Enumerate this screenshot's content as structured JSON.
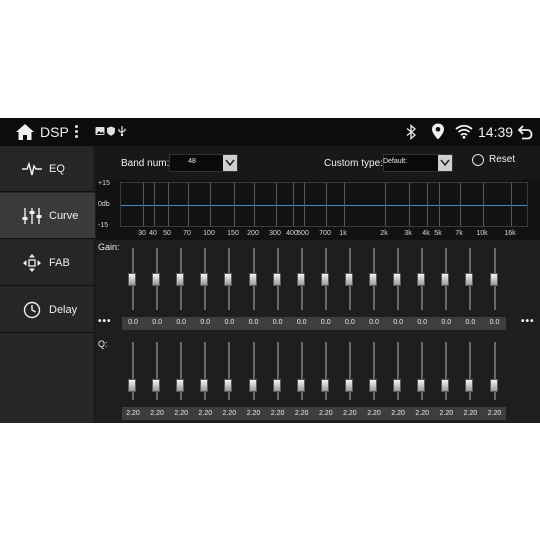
{
  "status_bar": {
    "title": "DSP",
    "time": "14:39",
    "icons": [
      "home-icon",
      "kebab-menu-icon",
      "image-notification-icon",
      "shield-notification-icon",
      "usb-notification-icon",
      "bluetooth-icon",
      "location-icon",
      "wifi-icon",
      "back-icon"
    ]
  },
  "sidebar": {
    "items": [
      {
        "label": "EQ",
        "icon": "eq-wave-icon",
        "active": false
      },
      {
        "label": "Curve",
        "icon": "sliders-icon",
        "active": true
      },
      {
        "label": "FAB",
        "icon": "fader-arrows-icon",
        "active": false
      },
      {
        "label": "Delay",
        "icon": "clock-icon",
        "active": false
      }
    ]
  },
  "controls": {
    "band_num_label": "Band num:",
    "band_num_value": "48",
    "custom_type_label": "Custom type:",
    "custom_type_value": "Default:",
    "reset_label": "Reset"
  },
  "graph": {
    "y_labels": [
      "+15",
      "0db",
      "-15"
    ],
    "x_labels": [
      "30",
      "40",
      "50",
      "70",
      "100",
      "150",
      "200",
      "300",
      "400",
      "500",
      "700",
      "1k",
      "2k",
      "3k",
      "4k",
      "5k",
      "7k",
      "10k",
      "16k"
    ]
  },
  "gain": {
    "label": "Gain:",
    "values": [
      "0.0",
      "0.0",
      "0.0",
      "0.0",
      "0.0",
      "0.0",
      "0.0",
      "0.0",
      "0.0",
      "0.0",
      "0.0",
      "0.0",
      "0.0",
      "0.0",
      "0.0",
      "0.0"
    ],
    "more_left": "•••",
    "more_right": "•••"
  },
  "q": {
    "label": "Q:",
    "values": [
      "2.20",
      "2.20",
      "2.20",
      "2.20",
      "2.20",
      "2.20",
      "2.20",
      "2.20",
      "2.20",
      "2.20",
      "2.20",
      "2.20",
      "2.20",
      "2.20",
      "2.20",
      "2.20"
    ]
  },
  "colors": {
    "background": "#1e1e1e",
    "status_bar": "#0c0c0c",
    "active_item": "#3a3a3a",
    "zero_line": "#4d89c7"
  }
}
